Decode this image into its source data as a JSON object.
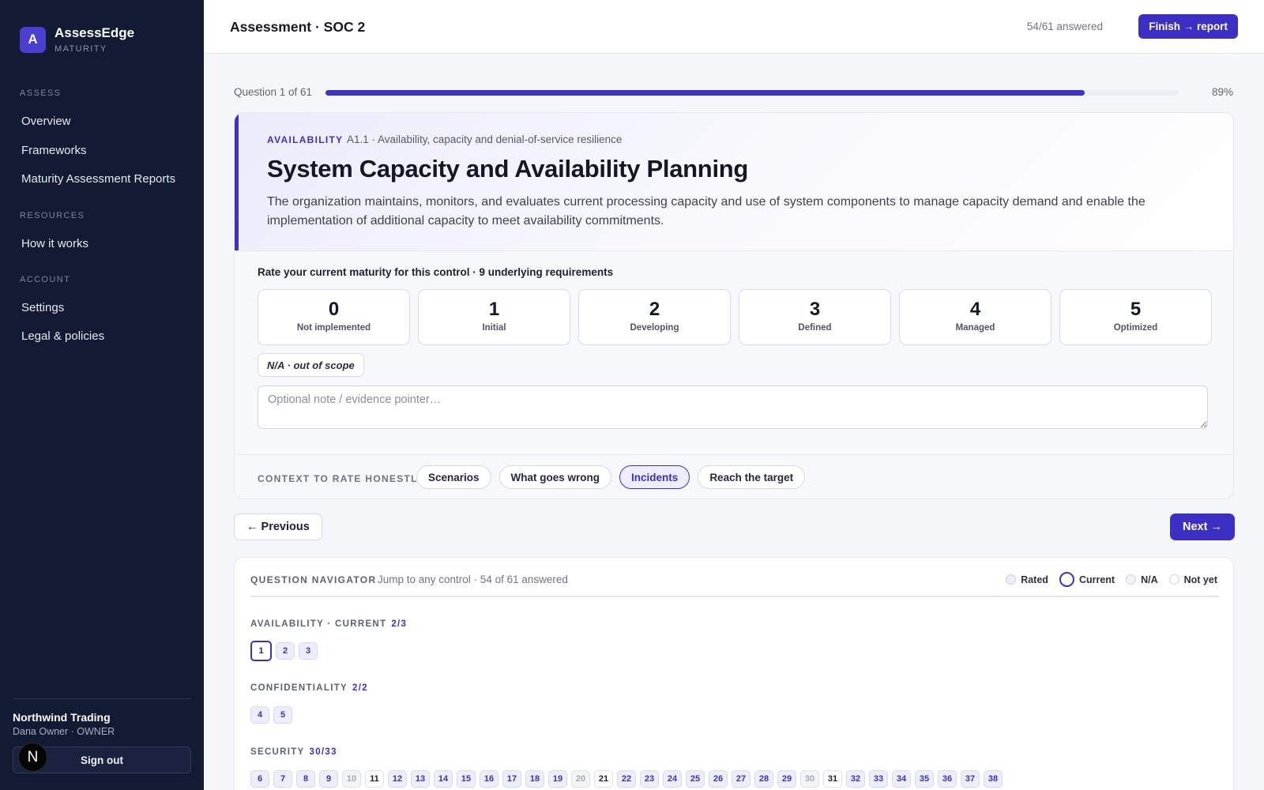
{
  "sidebar": {
    "brand_initial": "A",
    "brand_name": "AssessEdge",
    "brand_sub": "MATURITY",
    "sections": [
      {
        "title": "ASSESS",
        "items": [
          "Overview",
          "Frameworks",
          "Maturity Assessment Reports"
        ]
      },
      {
        "title": "RESOURCES",
        "items": [
          "How it works"
        ]
      },
      {
        "title": "ACCOUNT",
        "items": [
          "Settings",
          "Legal & policies"
        ]
      }
    ],
    "org_name": "Northwind Trading",
    "org_user": "Dana Owner · OWNER",
    "sign_out": "Sign out",
    "avatar_initial": "N"
  },
  "header": {
    "title": "Assessment · SOC 2",
    "answered": "54/61 answered",
    "finish": "Finish → report"
  },
  "progress": {
    "label": "Question 1 of 61",
    "percent_text": "89%",
    "fraction": 0.89
  },
  "question": {
    "category": "AVAILABILITY",
    "ref": "A1.1 · Availability, capacity and denial-of-service resilience",
    "title": "System Capacity and Availability Planning",
    "description": "The organization maintains, monitors, and evaluates current processing capacity and use of system components to manage capacity demand and enable the implementation of additional capacity to meet availability commitments.",
    "rate_title": "Rate your current maturity for this control · 9 underlying requirements",
    "levels": [
      {
        "num": "0",
        "label": "Not implemented"
      },
      {
        "num": "1",
        "label": "Initial"
      },
      {
        "num": "2",
        "label": "Developing"
      },
      {
        "num": "3",
        "label": "Defined"
      },
      {
        "num": "4",
        "label": "Managed"
      },
      {
        "num": "5",
        "label": "Optimized"
      }
    ],
    "na_label": "N/A · out of scope",
    "note_placeholder": "Optional note / evidence pointer…",
    "context_label": "CONTEXT TO RATE HONESTLY",
    "context_pills": [
      "Scenarios",
      "What goes wrong",
      "Incidents",
      "Reach the target"
    ],
    "active_pill": "Incidents"
  },
  "actions": {
    "previous": "← Previous",
    "next": "Next →"
  },
  "navigator": {
    "title": "QUESTION NAVIGATOR",
    "subtitle": "Jump to any control · 54 of 61 answered",
    "legend": [
      "Rated",
      "Current",
      "N/A",
      "Not yet"
    ],
    "groups": [
      {
        "label": "AVAILABILITY · CURRENT",
        "count": "2/3",
        "chips": [
          {
            "n": "1",
            "state": "current"
          },
          {
            "n": "2",
            "state": "rated"
          },
          {
            "n": "3",
            "state": "rated"
          }
        ]
      },
      {
        "label": "CONFIDENTIALITY",
        "count": "2/2",
        "chips": [
          {
            "n": "4",
            "state": "rated"
          },
          {
            "n": "5",
            "state": "rated"
          }
        ]
      },
      {
        "label": "SECURITY",
        "count": "30/33",
        "chips": [
          {
            "n": "6",
            "state": "rated"
          },
          {
            "n": "7",
            "state": "rated"
          },
          {
            "n": "8",
            "state": "rated"
          },
          {
            "n": "9",
            "state": "rated"
          },
          {
            "n": "10",
            "state": "na"
          },
          {
            "n": "11",
            "state": "notyet"
          },
          {
            "n": "12",
            "state": "rated"
          },
          {
            "n": "13",
            "state": "rated"
          },
          {
            "n": "14",
            "state": "rated"
          },
          {
            "n": "15",
            "state": "rated"
          },
          {
            "n": "16",
            "state": "rated"
          },
          {
            "n": "17",
            "state": "rated"
          },
          {
            "n": "18",
            "state": "rated"
          },
          {
            "n": "19",
            "state": "rated"
          },
          {
            "n": "20",
            "state": "na"
          },
          {
            "n": "21",
            "state": "notyet"
          },
          {
            "n": "22",
            "state": "rated"
          },
          {
            "n": "23",
            "state": "rated"
          },
          {
            "n": "24",
            "state": "rated"
          },
          {
            "n": "25",
            "state": "rated"
          },
          {
            "n": "26",
            "state": "rated"
          },
          {
            "n": "27",
            "state": "rated"
          },
          {
            "n": "28",
            "state": "rated"
          },
          {
            "n": "29",
            "state": "rated"
          },
          {
            "n": "30",
            "state": "na"
          },
          {
            "n": "31",
            "state": "notyet"
          },
          {
            "n": "32",
            "state": "rated"
          },
          {
            "n": "33",
            "state": "rated"
          },
          {
            "n": "34",
            "state": "rated"
          },
          {
            "n": "35",
            "state": "rated"
          },
          {
            "n": "36",
            "state": "rated"
          },
          {
            "n": "37",
            "state": "rated"
          },
          {
            "n": "38",
            "state": "rated"
          }
        ]
      }
    ]
  },
  "colors": {
    "accent": "#3d30c7",
    "sidebar_bg": "#131a33"
  }
}
